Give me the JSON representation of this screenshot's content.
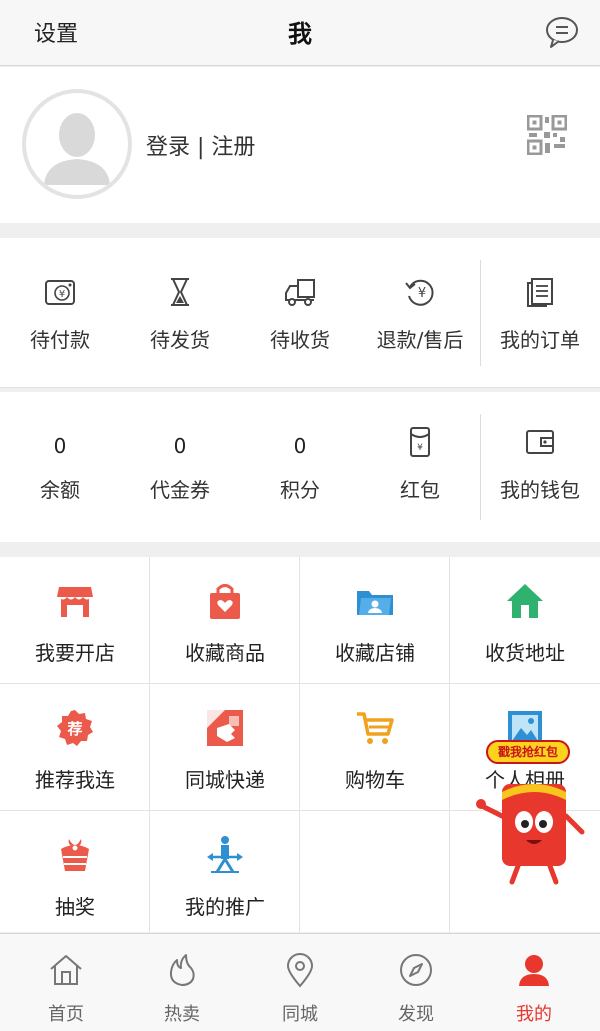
{
  "nav": {
    "left": "设置",
    "title": "我",
    "message_icon": "message-icon"
  },
  "profile": {
    "login_text": "登录 | 注册",
    "avatar_icon": "user-avatar-icon",
    "qr_icon": "qr-code-icon"
  },
  "orders": [
    {
      "label": "待付款",
      "icon": "wallet-yuan-icon"
    },
    {
      "label": "待发货",
      "icon": "hourglass-icon"
    },
    {
      "label": "待收货",
      "icon": "truck-icon"
    },
    {
      "label": "退款/售后",
      "icon": "refund-icon"
    },
    {
      "label": "我的订单",
      "icon": "orders-list-icon"
    }
  ],
  "wallet": [
    {
      "value": "0",
      "label": "余额"
    },
    {
      "value": "0",
      "label": "代金券"
    },
    {
      "value": "0",
      "label": "积分"
    },
    {
      "label": "红包",
      "icon": "red-packet-icon"
    },
    {
      "label": "我的钱包",
      "icon": "wallet-icon"
    }
  ],
  "grid": [
    {
      "label": "我要开店",
      "icon": "shop-icon",
      "color": "#ec5a4b"
    },
    {
      "label": "收藏商品",
      "icon": "favorite-bag-icon",
      "color": "#ec5a4b"
    },
    {
      "label": "收藏店铺",
      "icon": "folder-user-icon",
      "color": "#2f8fd3"
    },
    {
      "label": "收货地址",
      "icon": "home-icon",
      "color": "#2fb16f"
    },
    {
      "label": "推荐我连",
      "icon": "recommend-icon",
      "color": "#ec5a4b"
    },
    {
      "label": "同城快递",
      "icon": "courier-icon",
      "color": "#ec5a4b"
    },
    {
      "label": "购物车",
      "icon": "cart-icon",
      "color": "#f0a21f"
    },
    {
      "label": "个人相册",
      "icon": "album-icon",
      "color": "#2f8fd3"
    },
    {
      "label": "抽奖",
      "icon": "lottery-icon",
      "color": "#ec5a4b"
    },
    {
      "label": "我的推广",
      "icon": "promotion-icon",
      "color": "#2f8fd3"
    }
  ],
  "floating": {
    "tag": "戳我抢红包",
    "icon": "red-envelope-mascot-icon"
  },
  "tabs": [
    {
      "label": "首页",
      "icon": "home-tab-icon"
    },
    {
      "label": "热卖",
      "icon": "flame-icon"
    },
    {
      "label": "同城",
      "icon": "location-pin-icon"
    },
    {
      "label": "发现",
      "icon": "compass-icon"
    },
    {
      "label": "我的",
      "icon": "person-icon",
      "active": true
    }
  ],
  "colors": {
    "accent": "#e8372c",
    "background": "#efefef"
  }
}
